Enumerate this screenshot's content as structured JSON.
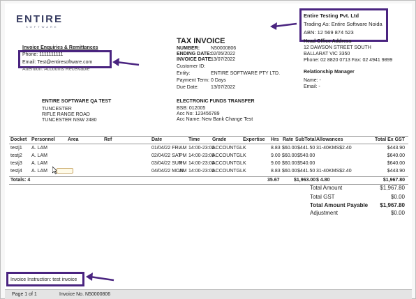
{
  "brand": {
    "logo": "ENTIRE",
    "logo_sub": "SOFTWARE"
  },
  "company_box": {
    "name": "Entire Testing Pvt. Ltd",
    "trading": "Trading As: Entire Software Noida",
    "abn": "ABN: 12 569 874 523"
  },
  "enquiries": {
    "title": "Invoice Enquiries & Remittances",
    "phone": "Phone: 1111111111",
    "email": "Email: Test@entiresoftware.com",
    "attention": "Attention: Accounts Receivable"
  },
  "invoice": {
    "title": "TAX INVOICE",
    "labels": [
      "NUMBER:",
      "ENDING DATE:",
      "INVOICE DATE:"
    ],
    "values": [
      "N50000806",
      "02/05/2022",
      "13/07/2022"
    ],
    "info_labels": [
      "Customer ID:",
      "Entity:",
      "Payment Term:",
      "Due Date:"
    ],
    "info_values": [
      "",
      "ENTIRE SOFTWARE PTY LTD.",
      "0 Days",
      "13/07/2022"
    ]
  },
  "head_office": {
    "title": "Head Office Address",
    "line1": "12 DAWSON STREET SOUTH",
    "line2": "BALLARAT  VIC  3350",
    "line3": "Phone: 02 8820 0713 Fax: 02 4941 9899"
  },
  "relationship": {
    "title": "Relationship Manager",
    "name": "Name: -",
    "email": "Email: -"
  },
  "customer": {
    "name": "ENTIRE SOFTWARE QA TEST",
    "line1": "TUNCESTER",
    "line2": "RIFLE RANGE ROAD",
    "line3": "TUNCESTER  NSW  2480"
  },
  "eft": {
    "title": "ELECTRONIC FUNDS TRANSFER",
    "bsb": "BSB: 012005",
    "acc_no": "Acc No: 123456789",
    "acc_name": "Acc Name: New Bank Change Test"
  },
  "table": {
    "headers": [
      "Docket",
      "Personnel",
      "Area",
      "Ref",
      "Date",
      "Time",
      "Grade",
      "Expertise",
      "Hrs",
      "Rate",
      "SubTotal",
      "Allowances",
      "Total Ex GST"
    ],
    "rows": [
      [
        "testj1",
        "A. LAM",
        "",
        "",
        "01/04/22 FRI",
        "AM",
        "14:00-23:00",
        "ACCOUNTGLK",
        "",
        "8.83",
        "$60.00",
        "$441.50",
        "31-40KMS$2.40",
        "$443.90"
      ],
      [
        "testj2",
        "A. LAM",
        "",
        "",
        "02/04/22 SAT",
        "PM",
        "14:00-23:00",
        "ACCOUNTGLK",
        "",
        "9.00",
        "$60.00",
        "$540.00",
        "",
        "$640.00"
      ],
      [
        "testj3",
        "A. LAM",
        "",
        "",
        "03/04/22 SUN",
        "PM",
        "14:00-23:00",
        "ACCOUNTGLK",
        "",
        "9.00",
        "$60.00",
        "$540.00",
        "",
        "$640.00"
      ],
      [
        "testj4",
        "A. LAM",
        "",
        "",
        "04/04/22 MON",
        "AM",
        "14:00-23:00",
        "ACCOUNTGLK",
        "",
        "8.83",
        "$60.00",
        "$441.50",
        "31-40KMS$2.40",
        "$443.90"
      ]
    ],
    "totals": {
      "label": "Totals: 4",
      "hrs": "35.67",
      "subtotal": "$1,963.00",
      "allow": "$ 4.80",
      "total": "$1,967.80"
    }
  },
  "summary": {
    "total_amount_label": "Total Amount",
    "total_amount": "$1,967.80",
    "total_gst_label": "Total GST",
    "total_gst": "$0.00",
    "payable_label": "Total Amount Payable",
    "payable": "$1,967.80",
    "adjust_label": "Adjustment",
    "adjust": "$0.00"
  },
  "instruction": "Invoice Instruction: test invoice",
  "footer": {
    "page": "Page 1 of 1",
    "invoice_no": "Invoice No. N50000806"
  },
  "colors": {
    "highlight": "#4a2480",
    "logo": "#3a3f63"
  }
}
